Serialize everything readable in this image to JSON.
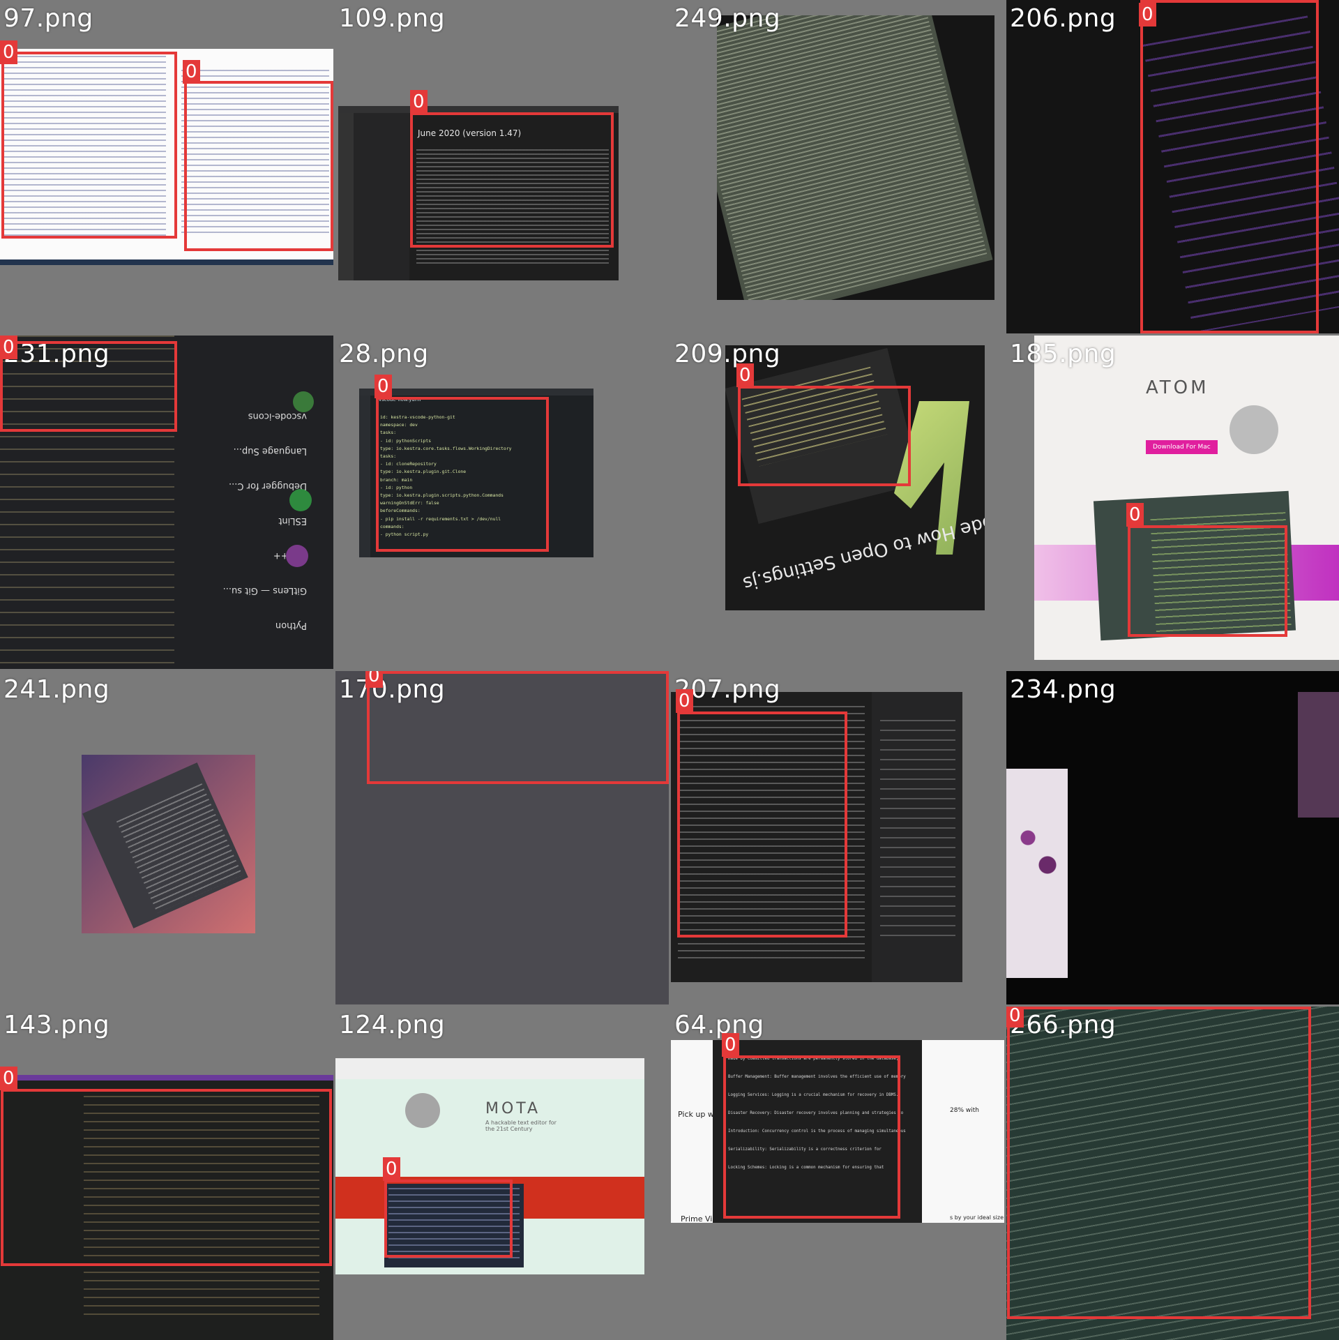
{
  "grid": {
    "tiles": [
      {
        "file": "97.png",
        "labels": [
          "0",
          "0"
        ]
      },
      {
        "file": "109.png",
        "labels": [
          "0"
        ],
        "heading": "June 2020 (version 1.47)"
      },
      {
        "file": "249.png",
        "labels": []
      },
      {
        "file": "206.png",
        "labels": [
          "0"
        ]
      },
      {
        "file": "231.png",
        "labels": [
          "0"
        ],
        "extension_names": [
          "Python",
          "GitLens — Git su...",
          "CI/C++",
          "ESLint",
          "Debugger for C...",
          "Language Sup...",
          "vscode-icons"
        ]
      },
      {
        "file": "28.png",
        "labels": [
          "0"
        ],
        "tab": "vscode-flow.yaml",
        "code_lines": [
          "id: kestra-vscode-python-git",
          "namespace: dev",
          "tasks:",
          "  - id: pythonScripts",
          "    type: io.kestra.core.tasks.flows.WorkingDirectory",
          "    tasks:",
          "      - id: cloneRepository",
          "        type: io.kestra.plugin.git.Clone",
          "        branch: main",
          "      - id: python",
          "        type: io.kestra.plugin.scripts.python.Commands",
          "        warningOnStdErr: false",
          "        beforeCommands:",
          "          - pip install -r requirements.txt > /dev/null",
          "        commands:",
          "          - python script.py"
        ]
      },
      {
        "file": "209.png",
        "labels": [
          "0"
        ],
        "overlay_text": "Code How to Open Settings.js"
      },
      {
        "file": "185.png",
        "labels": [
          "0"
        ],
        "site_title": "ATOM",
        "download_button": "Download For Mac"
      },
      {
        "file": "241.png",
        "labels": []
      },
      {
        "file": "170.png",
        "labels": [
          "0"
        ]
      },
      {
        "file": "207.png",
        "labels": [
          "0"
        ]
      },
      {
        "file": "234.png",
        "labels": []
      },
      {
        "file": "143.png",
        "labels": [
          "0"
        ]
      },
      {
        "file": "124.png",
        "labels": [
          "0"
        ],
        "site_title": "MOTA",
        "tagline": "A hackable text editor for the 21st Century"
      },
      {
        "file": "64.png",
        "labels": [
          "0"
        ],
        "code_text": [
          "made by committed transactions are permanently stored in the database,",
          "Buffer Management: Buffer management involves the efficient use of memory",
          "Logging Services: Logging is a crucial mechanism for recovery in DBMS.",
          "Disaster Recovery: Disaster recovery involves planning and strategies to",
          "Introduction: Concurrency control is the process of managing simultaneous",
          "Serializability: Serializability is a correctness criterion for",
          "Locking Schemes: Locking is a common mechanism for ensuring that"
        ],
        "side_texts": [
          "Pick up wh",
          "Prime Vide",
          "28% with",
          "s by your ideal size"
        ]
      },
      {
        "file": "266.png",
        "labels": [
          "0"
        ]
      }
    ]
  },
  "colors": {
    "box": "#e43939",
    "background": "#7a7a7a",
    "label_text": "#ffffff"
  }
}
